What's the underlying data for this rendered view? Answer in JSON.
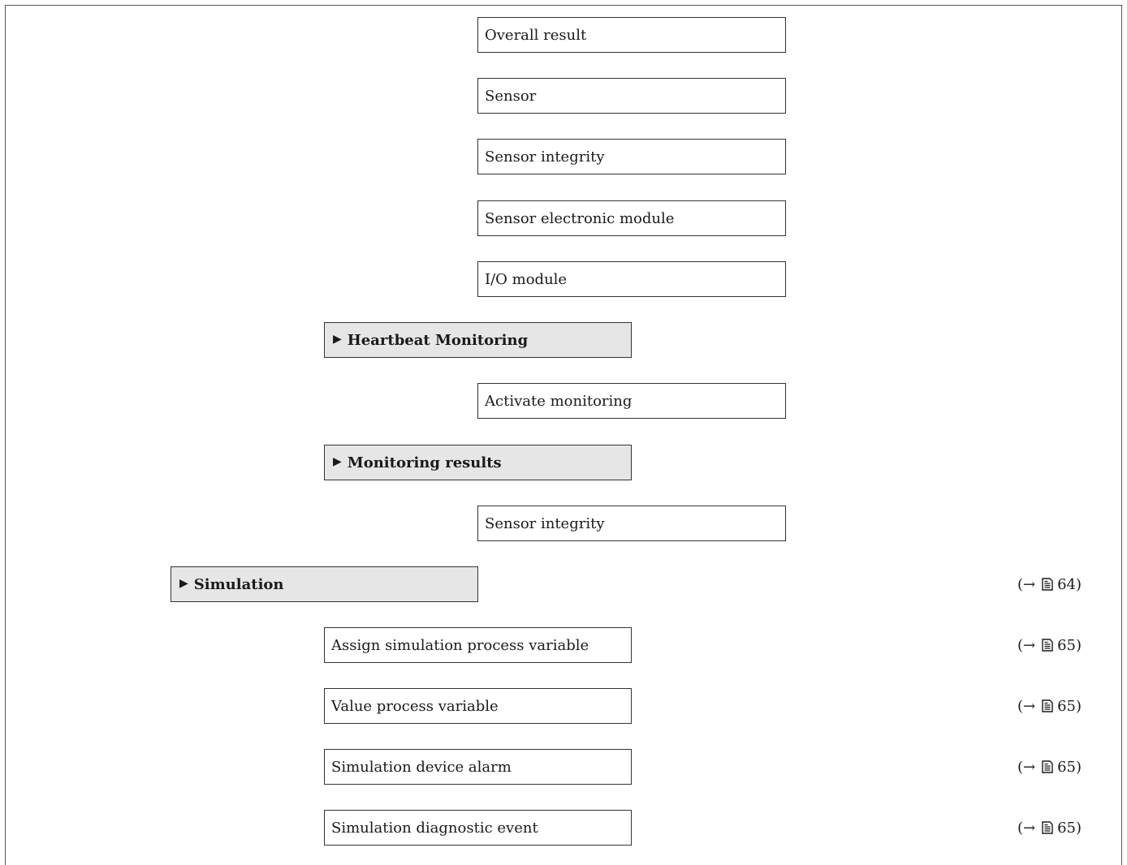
{
  "items": {
    "overall_result": "Overall result",
    "sensor": "Sensor",
    "sensor_integrity_1": "Sensor integrity",
    "sensor_electronic_module": "Sensor electronic module",
    "io_module": "I/O module",
    "heartbeat_monitoring": "Heartbeat Monitoring",
    "activate_monitoring": "Activate monitoring",
    "monitoring_results": "Monitoring results",
    "sensor_integrity_2": "Sensor integrity",
    "simulation": "Simulation",
    "assign_simulation_process_variable": "Assign simulation process variable",
    "value_process_variable": "Value process variable",
    "simulation_device_alarm": "Simulation device alarm",
    "simulation_diagnostic_event": "Simulation diagnostic event"
  },
  "icons": {
    "submenu_marker": "triangle-right-icon",
    "page_ref": "document-icon"
  },
  "refs": {
    "simulation": {
      "open": "(→",
      "page": "64)"
    },
    "assign_simulation_process_variable": {
      "open": "(→",
      "page": "65)"
    },
    "value_process_variable": {
      "open": "(→",
      "page": "65)"
    },
    "simulation_device_alarm": {
      "open": "(→",
      "page": "65)"
    },
    "simulation_diagnostic_event": {
      "open": "(→",
      "page": "65)"
    }
  }
}
